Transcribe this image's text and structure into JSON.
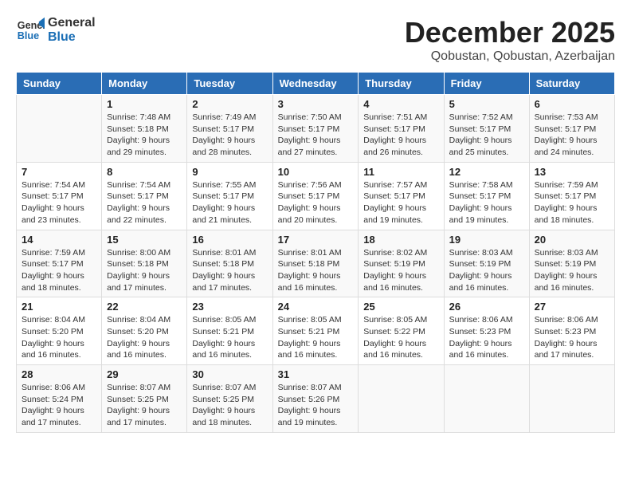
{
  "logo": {
    "line1": "General",
    "line2": "Blue"
  },
  "title": "December 2025",
  "subtitle": "Qobustan, Qobustan, Azerbaijan",
  "days_of_week": [
    "Sunday",
    "Monday",
    "Tuesday",
    "Wednesday",
    "Thursday",
    "Friday",
    "Saturday"
  ],
  "weeks": [
    [
      {
        "day": "",
        "info": ""
      },
      {
        "day": "1",
        "info": "Sunrise: 7:48 AM\nSunset: 5:18 PM\nDaylight: 9 hours\nand 29 minutes."
      },
      {
        "day": "2",
        "info": "Sunrise: 7:49 AM\nSunset: 5:17 PM\nDaylight: 9 hours\nand 28 minutes."
      },
      {
        "day": "3",
        "info": "Sunrise: 7:50 AM\nSunset: 5:17 PM\nDaylight: 9 hours\nand 27 minutes."
      },
      {
        "day": "4",
        "info": "Sunrise: 7:51 AM\nSunset: 5:17 PM\nDaylight: 9 hours\nand 26 minutes."
      },
      {
        "day": "5",
        "info": "Sunrise: 7:52 AM\nSunset: 5:17 PM\nDaylight: 9 hours\nand 25 minutes."
      },
      {
        "day": "6",
        "info": "Sunrise: 7:53 AM\nSunset: 5:17 PM\nDaylight: 9 hours\nand 24 minutes."
      }
    ],
    [
      {
        "day": "7",
        "info": "Sunrise: 7:54 AM\nSunset: 5:17 PM\nDaylight: 9 hours\nand 23 minutes."
      },
      {
        "day": "8",
        "info": "Sunrise: 7:54 AM\nSunset: 5:17 PM\nDaylight: 9 hours\nand 22 minutes."
      },
      {
        "day": "9",
        "info": "Sunrise: 7:55 AM\nSunset: 5:17 PM\nDaylight: 9 hours\nand 21 minutes."
      },
      {
        "day": "10",
        "info": "Sunrise: 7:56 AM\nSunset: 5:17 PM\nDaylight: 9 hours\nand 20 minutes."
      },
      {
        "day": "11",
        "info": "Sunrise: 7:57 AM\nSunset: 5:17 PM\nDaylight: 9 hours\nand 19 minutes."
      },
      {
        "day": "12",
        "info": "Sunrise: 7:58 AM\nSunset: 5:17 PM\nDaylight: 9 hours\nand 19 minutes."
      },
      {
        "day": "13",
        "info": "Sunrise: 7:59 AM\nSunset: 5:17 PM\nDaylight: 9 hours\nand 18 minutes."
      }
    ],
    [
      {
        "day": "14",
        "info": "Sunrise: 7:59 AM\nSunset: 5:17 PM\nDaylight: 9 hours\nand 18 minutes."
      },
      {
        "day": "15",
        "info": "Sunrise: 8:00 AM\nSunset: 5:18 PM\nDaylight: 9 hours\nand 17 minutes."
      },
      {
        "day": "16",
        "info": "Sunrise: 8:01 AM\nSunset: 5:18 PM\nDaylight: 9 hours\nand 17 minutes."
      },
      {
        "day": "17",
        "info": "Sunrise: 8:01 AM\nSunset: 5:18 PM\nDaylight: 9 hours\nand 16 minutes."
      },
      {
        "day": "18",
        "info": "Sunrise: 8:02 AM\nSunset: 5:19 PM\nDaylight: 9 hours\nand 16 minutes."
      },
      {
        "day": "19",
        "info": "Sunrise: 8:03 AM\nSunset: 5:19 PM\nDaylight: 9 hours\nand 16 minutes."
      },
      {
        "day": "20",
        "info": "Sunrise: 8:03 AM\nSunset: 5:19 PM\nDaylight: 9 hours\nand 16 minutes."
      }
    ],
    [
      {
        "day": "21",
        "info": "Sunrise: 8:04 AM\nSunset: 5:20 PM\nDaylight: 9 hours\nand 16 minutes."
      },
      {
        "day": "22",
        "info": "Sunrise: 8:04 AM\nSunset: 5:20 PM\nDaylight: 9 hours\nand 16 minutes."
      },
      {
        "day": "23",
        "info": "Sunrise: 8:05 AM\nSunset: 5:21 PM\nDaylight: 9 hours\nand 16 minutes."
      },
      {
        "day": "24",
        "info": "Sunrise: 8:05 AM\nSunset: 5:21 PM\nDaylight: 9 hours\nand 16 minutes."
      },
      {
        "day": "25",
        "info": "Sunrise: 8:05 AM\nSunset: 5:22 PM\nDaylight: 9 hours\nand 16 minutes."
      },
      {
        "day": "26",
        "info": "Sunrise: 8:06 AM\nSunset: 5:23 PM\nDaylight: 9 hours\nand 16 minutes."
      },
      {
        "day": "27",
        "info": "Sunrise: 8:06 AM\nSunset: 5:23 PM\nDaylight: 9 hours\nand 17 minutes."
      }
    ],
    [
      {
        "day": "28",
        "info": "Sunrise: 8:06 AM\nSunset: 5:24 PM\nDaylight: 9 hours\nand 17 minutes."
      },
      {
        "day": "29",
        "info": "Sunrise: 8:07 AM\nSunset: 5:25 PM\nDaylight: 9 hours\nand 17 minutes."
      },
      {
        "day": "30",
        "info": "Sunrise: 8:07 AM\nSunset: 5:25 PM\nDaylight: 9 hours\nand 18 minutes."
      },
      {
        "day": "31",
        "info": "Sunrise: 8:07 AM\nSunset: 5:26 PM\nDaylight: 9 hours\nand 19 minutes."
      },
      {
        "day": "",
        "info": ""
      },
      {
        "day": "",
        "info": ""
      },
      {
        "day": "",
        "info": ""
      }
    ]
  ]
}
